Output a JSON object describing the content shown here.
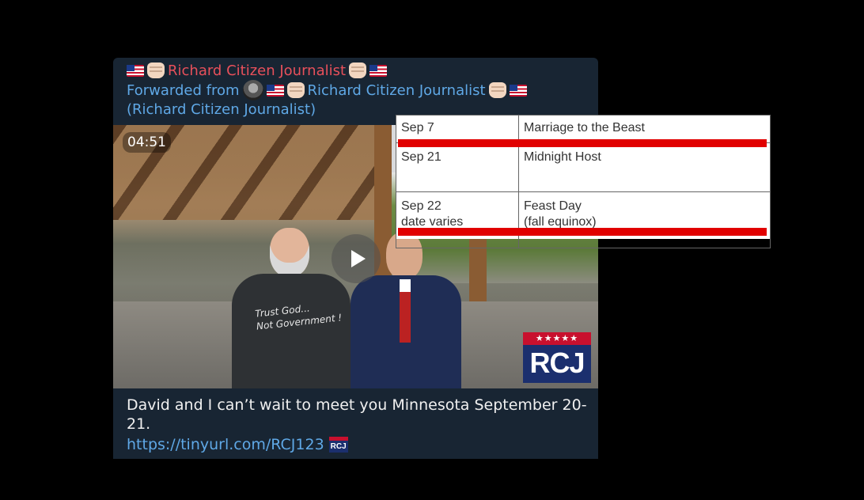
{
  "message": {
    "author": "Richard Citizen Journalist",
    "forwarded_prefix": "Forwarded from",
    "forwarded_name": "Richard Citizen Journalist",
    "forwarded_sub": "(Richard Citizen Journalist)",
    "video": {
      "duration": "04:51",
      "shirt_text_line1": "Trust God...",
      "shirt_text_line2": "Not Government !",
      "logo_stars": "★★★★★",
      "logo_text": "RCJ"
    },
    "caption": "David and I can’t wait to meet you Minnesota September 20-21.",
    "link": "https://tinyurl.com/RCJ123"
  },
  "overlay_table": {
    "rows": [
      {
        "date": "Sep 7",
        "date2": "",
        "event": "Marriage to the Beast",
        "event2": ""
      },
      {
        "date": "Sep 21",
        "date2": "",
        "event": "Midnight Host",
        "event2": ""
      },
      {
        "date": "Sep 22",
        "date2": "date varies",
        "event": "Feast Day",
        "event2": "(fall equinox)"
      }
    ]
  },
  "colors": {
    "background": "#000000",
    "card": "#182533",
    "author": "#e8505b",
    "link": "#5fa8e6",
    "highlight": "#e10000"
  }
}
